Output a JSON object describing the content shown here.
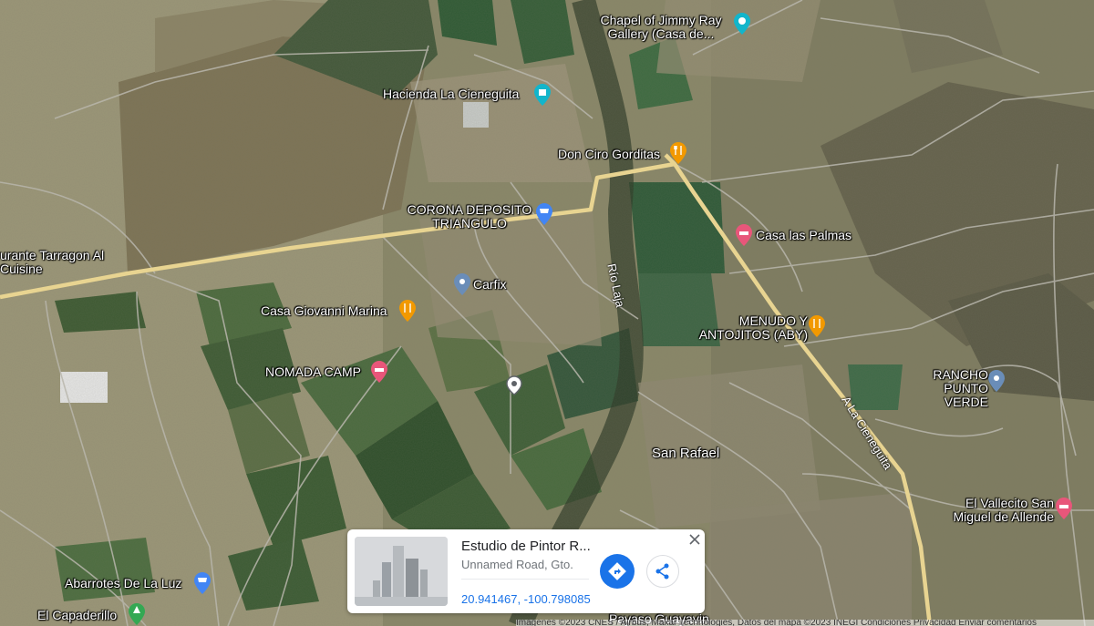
{
  "places": {
    "chapel": "Chapel of Jimmy Ray Gallery (Casa de...",
    "hacienda": "Hacienda La Cieneguita",
    "don_ciro": "Don Ciro Gorditas",
    "corona": "CORONA DEPOSITO TRIANGULO",
    "casa_palmas": "Casa las Palmas",
    "tarragon": "urante Tarragon Al Cuisine",
    "carfix": "Carfix",
    "giovanni": "Casa Giovanni Marina",
    "menudo": "MENUDO Y ANTOJITOS (ABY)",
    "nomada": "NOMADA CAMP",
    "rancho": "RANCHO PUNTO VERDE",
    "san_rafael": "San Rafael",
    "vallecito": "El Vallecito San Miguel de Allende",
    "abarrotes": "Abarrotes De La Luz",
    "capadero": "El Capaderillo",
    "payaso": "Payaso Guayavin"
  },
  "roads": {
    "rio": "Río Laja",
    "cieneguita": "A La Cieneguita"
  },
  "info_card": {
    "title": "Estudio de Pintor R...",
    "address": "Unnamed Road, Gto.",
    "coordinates": "20.941467, -100.798085"
  },
  "footer": {
    "attribution": "Imágenes ©2023 CNES / Airbus, Maxar Technologies, Datos del mapa ©2023 INEGI    Condiciones    Privacidad    Enviar comentarios"
  },
  "colors": {
    "road": "#e8d491",
    "food_pin": "#f29900",
    "lodging_pin": "#e8567a",
    "shop_pin": "#4285f4",
    "generic_pin": "#6a8db8",
    "park_pin": "#34a853",
    "direction_button": "#1a73e8"
  }
}
